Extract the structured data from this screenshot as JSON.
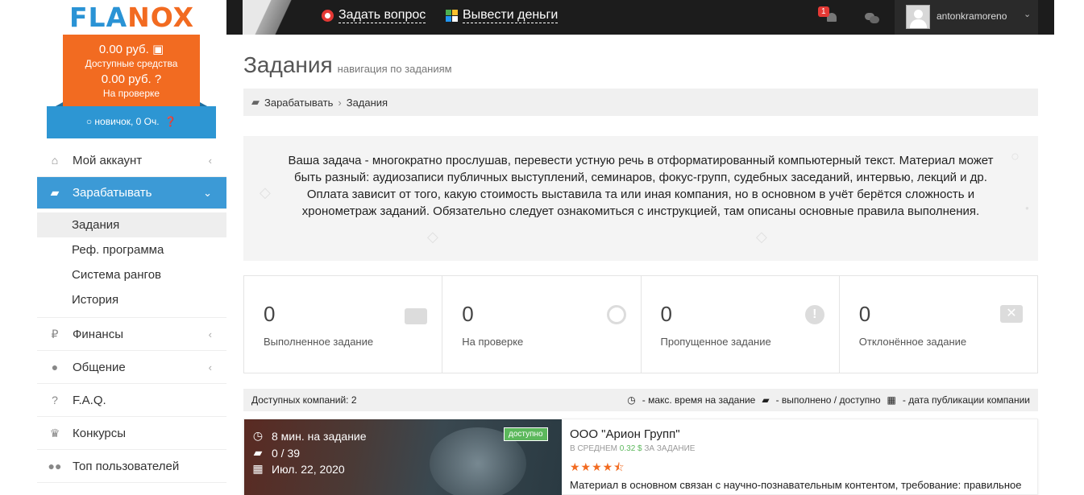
{
  "header": {
    "logo_part1": "FLA",
    "logo_part2": "NOX",
    "ask_question": "Задать вопрос",
    "withdraw": "Вывести деньги",
    "notifications_count": "1",
    "username": "antonkramoreno",
    "user_chevron": "⌄"
  },
  "balance": {
    "available_amount": "0.00 руб.",
    "available_label": "Доступные средства",
    "pending_amount": "0.00 руб.",
    "pending_label": "На проверке",
    "rank": "новичок, 0 Оч."
  },
  "sidebar": {
    "items": [
      {
        "label": "Мой аккаунт",
        "icon": "home-icon"
      },
      {
        "label": "Зарабатывать",
        "icon": "briefcase-icon"
      },
      {
        "label": "Финансы",
        "icon": "ruble-icon"
      },
      {
        "label": "Общение",
        "icon": "chat-icon"
      },
      {
        "label": "F.A.Q.",
        "icon": "question-icon"
      },
      {
        "label": "Конкурсы",
        "icon": "trophy-icon"
      },
      {
        "label": "Топ пользователей",
        "icon": "users-icon"
      }
    ],
    "submenu": [
      {
        "label": "Задания"
      },
      {
        "label": "Реф. программа"
      },
      {
        "label": "Система рангов"
      },
      {
        "label": "История"
      }
    ]
  },
  "page": {
    "title": "Задания",
    "subtitle": "навигация по заданиям",
    "breadcrumb_1": "Зарабатывать",
    "breadcrumb_2": "Задания",
    "description": "Ваша задача - многократно прослушав, перевести устную речь в отформатированный компьютерный текст. Материал может быть разный: аудиозаписи публичных выступлений, семинаров, фокус-групп, судебных заседаний, интервью, лекций и др. Оплата зависит от того, какую стоимость выставила та или иная компания, но в основном в учёт берётся сложность и хронометраж заданий. Обязательно следует ознакомиться с инструкцией, там описаны основные правила выполнения."
  },
  "stats": [
    {
      "value": "0",
      "label": "Выполненное задание",
      "icon": "briefcase-icon"
    },
    {
      "value": "0",
      "label": "На проверке",
      "icon": "clock-icon"
    },
    {
      "value": "0",
      "label": "Пропущенное задание",
      "icon": "exclamation-icon"
    },
    {
      "value": "0",
      "label": "Отклонённое задание",
      "icon": "close-icon"
    }
  ],
  "companies_bar": {
    "count_label": "Доступных компаний: 2",
    "legend_time": "- макс. время на задание",
    "legend_done": "- выполнено / доступно",
    "legend_date": "- дата публикации компании"
  },
  "card": {
    "time": "8 мин. на задание",
    "progress": "0 / 39",
    "date": "Июл. 22, 2020",
    "badge": "доступно",
    "company": "ООО \"Арион Групп\"",
    "avg_prefix": "в среднем",
    "avg_money": "0.32 $",
    "avg_suffix": "за задание",
    "rating": 4.5,
    "stars_text": "★★★★⯪",
    "description": "Материал в основном связан с научно-познавательным контентом, требование: правильное"
  },
  "colors": {
    "brand_orange": "#f26b21",
    "brand_blue": "#2a93d5",
    "sidebar_active": "#3c9ad6",
    "success": "#5cb85c"
  }
}
